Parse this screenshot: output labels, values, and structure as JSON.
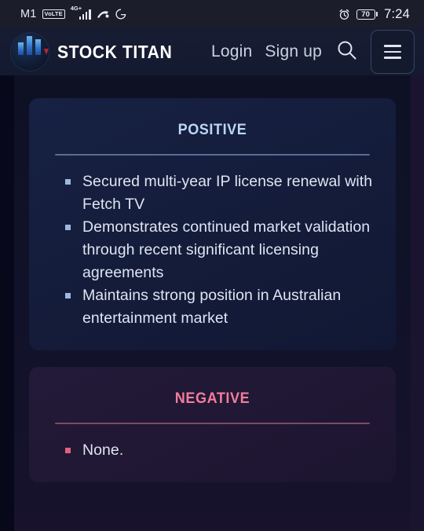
{
  "statusbar": {
    "carrier": "M1",
    "volte_badge": "VoLTE",
    "network": "4G+",
    "icons": [
      "signal-bars-icon",
      "vpn-icon",
      "google-icon"
    ],
    "alarm_icon": "alarm-clock-icon",
    "battery_level": "70",
    "time": "7:24"
  },
  "header": {
    "brand_name": "STOCK TITAN",
    "logo": "stock-titan-logo",
    "login_label": "Login",
    "signup_label": "Sign up",
    "search_icon": "search-icon",
    "menu_icon": "hamburger-menu-icon"
  },
  "main": {
    "positive": {
      "title": "Positive",
      "accent_color": "#bcd6f4",
      "points": [
        "Secured multi-year IP license renewal with Fetch TV",
        "Demonstrates continued market validation through recent significant licensing agreements",
        "Maintains strong position in Australian entertainment market"
      ]
    },
    "negative": {
      "title": "Negative",
      "accent_color": "#f27d9c",
      "points": [
        "None."
      ]
    }
  }
}
